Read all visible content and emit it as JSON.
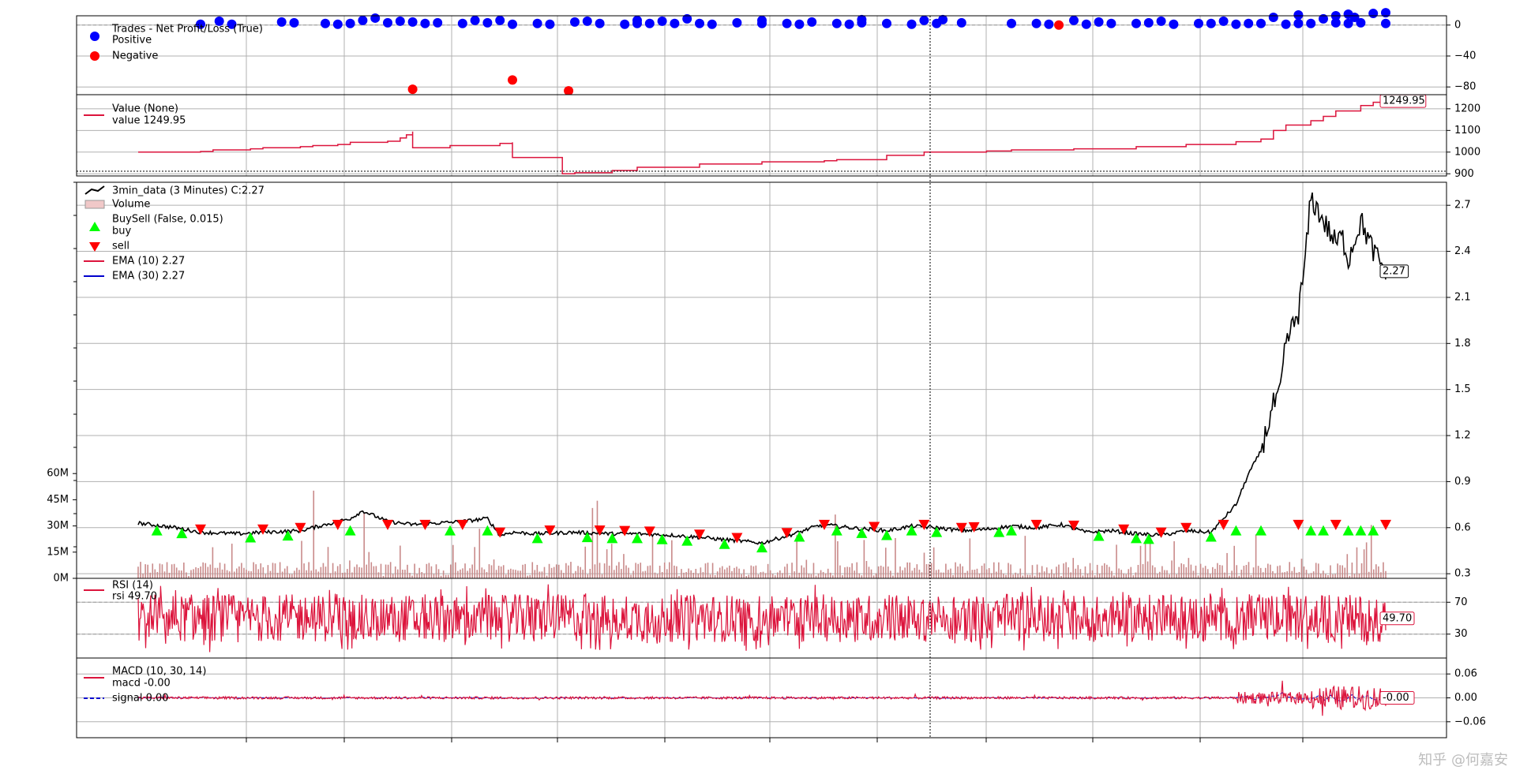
{
  "watermark": "知乎 @何嘉安",
  "colors": {
    "positive": "#0000ff",
    "negative": "#ff0000",
    "value": "#dc143c",
    "price": "#000000",
    "buy": "#00ff00",
    "sell": "#ff0000",
    "ema10": "#dc143c",
    "ema30": "#0000cd",
    "rsi": "#dc143c",
    "macd": "#dc143c",
    "signal": "#0000cd",
    "volume": "#c98a8a",
    "grid": "#b0b0b0"
  },
  "chart_data": [
    {
      "id": "trades",
      "type": "scatter",
      "legend": {
        "title": "Trades - Net Profit/Loss (True)",
        "positive_label": "Positive",
        "negative_label": "Negative"
      },
      "ylim": [
        -90,
        12
      ],
      "yticks": [
        0,
        -40,
        -80
      ],
      "ytick_labels": [
        "0",
        "−40",
        "−80"
      ],
      "x_range": [
        0,
        1
      ],
      "positive": [
        [
          0.05,
          1
        ],
        [
          0.075,
          1
        ],
        [
          0.125,
          3
        ],
        [
          0.15,
          2
        ],
        [
          0.16,
          1
        ],
        [
          0.17,
          2
        ],
        [
          0.2,
          3
        ],
        [
          0.22,
          4
        ],
        [
          0.23,
          2
        ],
        [
          0.24,
          3
        ],
        [
          0.26,
          2
        ],
        [
          0.28,
          3
        ],
        [
          0.3,
          1
        ],
        [
          0.32,
          2
        ],
        [
          0.33,
          1
        ],
        [
          0.35,
          4
        ],
        [
          0.37,
          2
        ],
        [
          0.39,
          1
        ],
        [
          0.4,
          2
        ],
        [
          0.41,
          2
        ],
        [
          0.43,
          2
        ],
        [
          0.45,
          2
        ],
        [
          0.46,
          1
        ],
        [
          0.48,
          3
        ],
        [
          0.5,
          2
        ],
        [
          0.52,
          2
        ],
        [
          0.53,
          1
        ],
        [
          0.56,
          2
        ],
        [
          0.57,
          1
        ],
        [
          0.58,
          3
        ],
        [
          0.6,
          2
        ],
        [
          0.62,
          1
        ],
        [
          0.64,
          2
        ],
        [
          0.66,
          3
        ],
        [
          0.7,
          2
        ],
        [
          0.72,
          2
        ],
        [
          0.73,
          1
        ],
        [
          0.76,
          1
        ],
        [
          0.78,
          2
        ],
        [
          0.8,
          2
        ],
        [
          0.81,
          3
        ],
        [
          0.83,
          1
        ],
        [
          0.85,
          2
        ],
        [
          0.86,
          2
        ],
        [
          0.88,
          1
        ],
        [
          0.89,
          2
        ],
        [
          0.9,
          2
        ],
        [
          0.92,
          1
        ],
        [
          0.93,
          2
        ],
        [
          0.94,
          2
        ],
        [
          0.96,
          3
        ],
        [
          0.97,
          2
        ],
        [
          0.98,
          3
        ],
        [
          1.0,
          2
        ]
      ],
      "positive_mid": [
        [
          0.065,
          5
        ],
        [
          0.115,
          4
        ],
        [
          0.18,
          6
        ],
        [
          0.19,
          9
        ],
        [
          0.21,
          5
        ],
        [
          0.27,
          6
        ],
        [
          0.29,
          6
        ],
        [
          0.36,
          5
        ],
        [
          0.4,
          6
        ],
        [
          0.42,
          5
        ],
        [
          0.44,
          8
        ],
        [
          0.5,
          6
        ],
        [
          0.54,
          4
        ],
        [
          0.58,
          7
        ],
        [
          0.63,
          6
        ],
        [
          0.645,
          7
        ],
        [
          0.75,
          6
        ],
        [
          0.77,
          4
        ],
        [
          0.82,
          5
        ],
        [
          0.87,
          5
        ],
        [
          0.91,
          10
        ],
        [
          0.93,
          13
        ],
        [
          0.95,
          8
        ],
        [
          0.96,
          12
        ],
        [
          0.97,
          14
        ],
        [
          0.975,
          10
        ],
        [
          0.99,
          15
        ],
        [
          1.0,
          16
        ]
      ],
      "negative": [
        [
          0.22,
          -83
        ],
        [
          0.3,
          -71
        ],
        [
          0.345,
          -85
        ],
        [
          0.738,
          0
        ]
      ]
    },
    {
      "id": "value",
      "type": "line",
      "legend": {
        "title": "Value (None)",
        "series_label": "value 1249.95"
      },
      "ylim": [
        890,
        1265
      ],
      "yticks": [
        900,
        1000,
        1100,
        1200
      ],
      "ytick_labels": [
        "900",
        "1000",
        "1100",
        "1200"
      ],
      "last_label": "1249.95",
      "x": [
        0,
        0.05,
        0.06,
        0.09,
        0.1,
        0.13,
        0.14,
        0.16,
        0.17,
        0.2,
        0.21,
        0.215,
        0.22,
        0.22,
        0.25,
        0.29,
        0.3,
        0.3,
        0.34,
        0.34,
        0.35,
        0.38,
        0.4,
        0.45,
        0.5,
        0.55,
        0.56,
        0.6,
        0.63,
        0.68,
        0.7,
        0.75,
        0.8,
        0.84,
        0.88,
        0.9,
        0.91,
        0.92,
        0.94,
        0.95,
        0.96,
        0.98,
        0.99,
        1.0
      ],
      "values": [
        1000,
        1003,
        1010,
        1015,
        1020,
        1025,
        1030,
        1035,
        1045,
        1050,
        1065,
        1080,
        1095,
        1020,
        1030,
        1040,
        1045,
        975,
        978,
        900,
        905,
        915,
        930,
        945,
        955,
        960,
        965,
        985,
        1000,
        1005,
        1010,
        1015,
        1025,
        1035,
        1048,
        1060,
        1100,
        1125,
        1145,
        1165,
        1190,
        1215,
        1230,
        1249.95
      ]
    },
    {
      "id": "price",
      "type": "line",
      "legend": {
        "title": "3min_data (3 Minutes) C:2.27",
        "volume_label": "Volume",
        "buysell_label": "BuySell (False, 0.015)",
        "buy_label": "buy",
        "sell_label": "sell",
        "ema10_label": "EMA (10) 2.27",
        "ema30_label": "EMA (30) 2.27"
      },
      "ylim": [
        0.27,
        2.85
      ],
      "yticks": [
        0.3,
        0.6,
        0.9,
        1.2,
        1.5,
        1.8,
        2.1,
        2.4,
        2.7
      ],
      "ytick_labels": [
        "0.3",
        "0.6",
        "0.9",
        "1.2",
        "1.5",
        "1.8",
        "2.1",
        "2.4",
        "2.7"
      ],
      "volume_ylim": [
        0,
        180000000
      ],
      "volume_yticks": [
        0,
        15000000,
        30000000,
        45000000,
        60000000
      ],
      "volume_ytick_labels": [
        "0M",
        "15M",
        "30M",
        "45M",
        "60M"
      ],
      "last_label": "2.27",
      "x": [
        0,
        0.03,
        0.05,
        0.08,
        0.1,
        0.13,
        0.15,
        0.17,
        0.18,
        0.2,
        0.22,
        0.24,
        0.26,
        0.28,
        0.29,
        0.3,
        0.32,
        0.35,
        0.38,
        0.4,
        0.43,
        0.46,
        0.5,
        0.53,
        0.54,
        0.55,
        0.57,
        0.6,
        0.62,
        0.64,
        0.66,
        0.68,
        0.7,
        0.72,
        0.74,
        0.76,
        0.78,
        0.8,
        0.82,
        0.84,
        0.86,
        0.88,
        0.89,
        0.9,
        0.91,
        0.915,
        0.92,
        0.93,
        0.935,
        0.94,
        0.95,
        0.96,
        0.965,
        0.97,
        0.98,
        0.99,
        1.0
      ],
      "values": [
        0.63,
        0.6,
        0.57,
        0.56,
        0.57,
        0.58,
        0.62,
        0.66,
        0.71,
        0.64,
        0.62,
        0.63,
        0.64,
        0.66,
        0.55,
        0.57,
        0.56,
        0.57,
        0.56,
        0.56,
        0.55,
        0.53,
        0.5,
        0.57,
        0.6,
        0.62,
        0.6,
        0.58,
        0.61,
        0.6,
        0.58,
        0.59,
        0.61,
        0.6,
        0.62,
        0.57,
        0.58,
        0.56,
        0.55,
        0.58,
        0.57,
        0.75,
        0.95,
        1.1,
        1.4,
        1.45,
        1.8,
        2.0,
        2.3,
        2.75,
        2.6,
        2.45,
        2.5,
        2.35,
        2.6,
        2.4,
        2.27
      ],
      "buy_x": [
        0.015,
        0.035,
        0.09,
        0.12,
        0.17,
        0.25,
        0.28,
        0.32,
        0.36,
        0.38,
        0.4,
        0.42,
        0.44,
        0.47,
        0.5,
        0.53,
        0.56,
        0.58,
        0.6,
        0.62,
        0.64,
        0.69,
        0.7,
        0.77,
        0.8,
        0.81,
        0.86,
        0.88,
        0.9,
        0.94,
        0.95,
        0.97,
        0.98,
        0.99
      ],
      "sell_x": [
        0.05,
        0.1,
        0.13,
        0.16,
        0.2,
        0.23,
        0.26,
        0.29,
        0.33,
        0.37,
        0.39,
        0.41,
        0.45,
        0.48,
        0.52,
        0.55,
        0.59,
        0.63,
        0.66,
        0.67,
        0.72,
        0.75,
        0.79,
        0.82,
        0.84,
        0.87,
        0.93,
        0.96,
        1.0
      ]
    },
    {
      "id": "rsi",
      "type": "line",
      "legend": {
        "title": "RSI (14)",
        "series_label": "rsi 49.70"
      },
      "ylim": [
        0,
        100
      ],
      "yticks": [
        30,
        70
      ],
      "ytick_labels": [
        "30",
        "70"
      ],
      "last_label": "49.70"
    },
    {
      "id": "macd",
      "type": "line",
      "legend": {
        "title": "MACD (10, 30, 14)",
        "macd_label": "macd -0.00",
        "signal_label": "signal 0.00"
      },
      "ylim": [
        -0.1,
        0.1
      ],
      "yticks": [
        0.06,
        0.0,
        -0.06
      ],
      "ytick_labels": [
        "0.06",
        "0.00",
        "−0.06"
      ],
      "last_label": "-0.00"
    }
  ]
}
